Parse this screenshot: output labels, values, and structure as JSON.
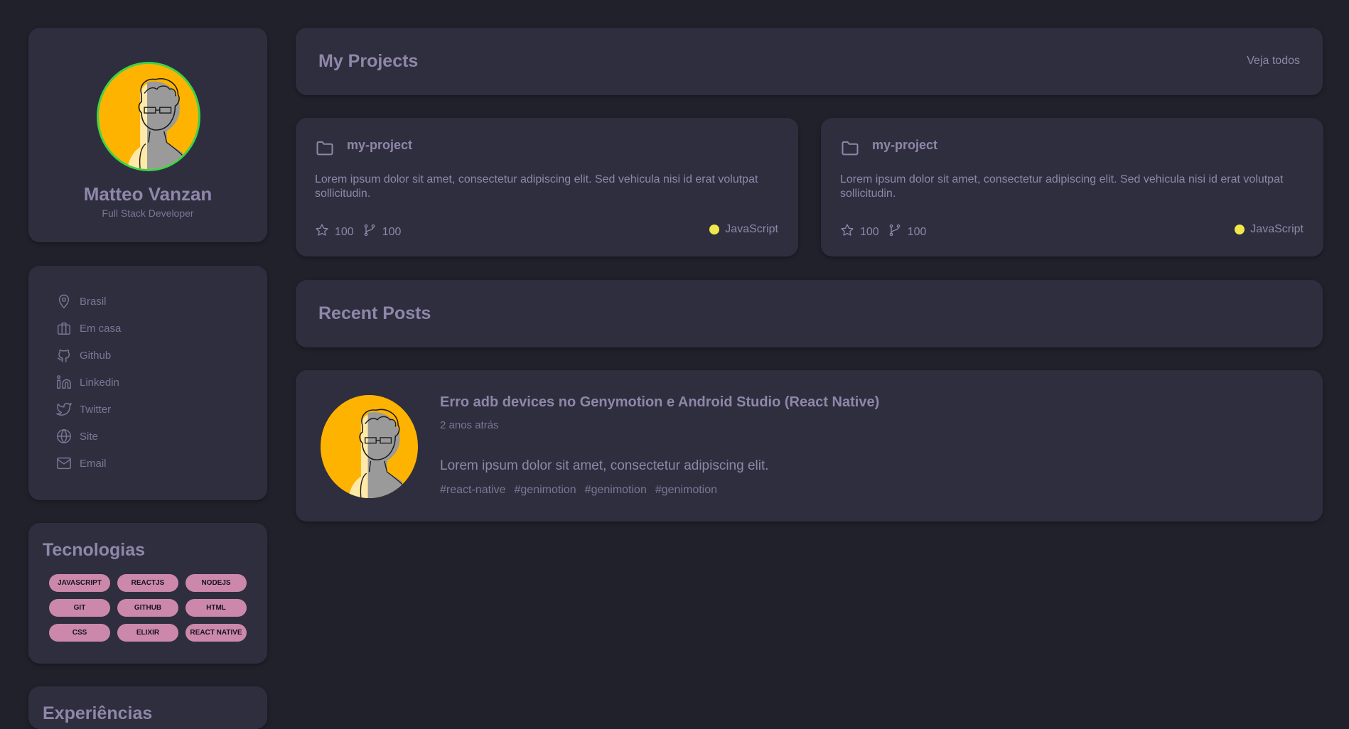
{
  "profile": {
    "name": "Matteo Vanzan",
    "role": "Full Stack Developer",
    "avatar_border_color": "#3ed34a",
    "avatar_bg_color": "#fdb300"
  },
  "links": [
    {
      "label": "Brasil",
      "icon": "map-pin-icon"
    },
    {
      "label": "Em casa",
      "icon": "briefcase-icon"
    },
    {
      "label": "Github",
      "icon": "github-icon"
    },
    {
      "label": "Linkedin",
      "icon": "linkedin-icon"
    },
    {
      "label": "Twitter",
      "icon": "twitter-icon"
    },
    {
      "label": "Site",
      "icon": "globe-icon"
    },
    {
      "label": "Email",
      "icon": "mail-icon"
    }
  ],
  "tech": {
    "title": "Tecnologias",
    "tags": [
      "JAVASCRIPT",
      "REACTJS",
      "NODEJS",
      "GIT",
      "GITHUB",
      "HTML",
      "CSS",
      "ELIXIR",
      "REACT NATIVE"
    ],
    "tag_color": "#cc88aa"
  },
  "experience": {
    "title": "Experiências"
  },
  "projects": {
    "title": "My Projects",
    "see_all": "Veja todos",
    "items": [
      {
        "name": "my-project",
        "description": "Lorem ipsum dolor sit amet, consectetur adipiscing elit. Sed vehicula nisi id erat volutpat sollicitudin.",
        "stars": "100",
        "forks": "100",
        "language": "JavaScript",
        "language_color": "#f0e84a"
      },
      {
        "name": "my-project",
        "description": "Lorem ipsum dolor sit amet, consectetur adipiscing elit. Sed vehicula nisi id erat volutpat sollicitudin.",
        "stars": "100",
        "forks": "100",
        "language": "JavaScript",
        "language_color": "#f0e84a"
      }
    ]
  },
  "posts": {
    "title": "Recent Posts",
    "items": [
      {
        "title": "Erro adb devices no Genymotion e Android Studio (React Native)",
        "date": "2 anos atrás",
        "body": "Lorem ipsum dolor sit amet, consectetur adipiscing elit.",
        "tags": [
          "#react-native",
          "#genimotion",
          "#genimotion",
          "#genimotion"
        ]
      }
    ]
  },
  "colors": {
    "page_bg": "#21212b",
    "card_bg": "#2f2e3e",
    "text": "#8f87aa"
  }
}
